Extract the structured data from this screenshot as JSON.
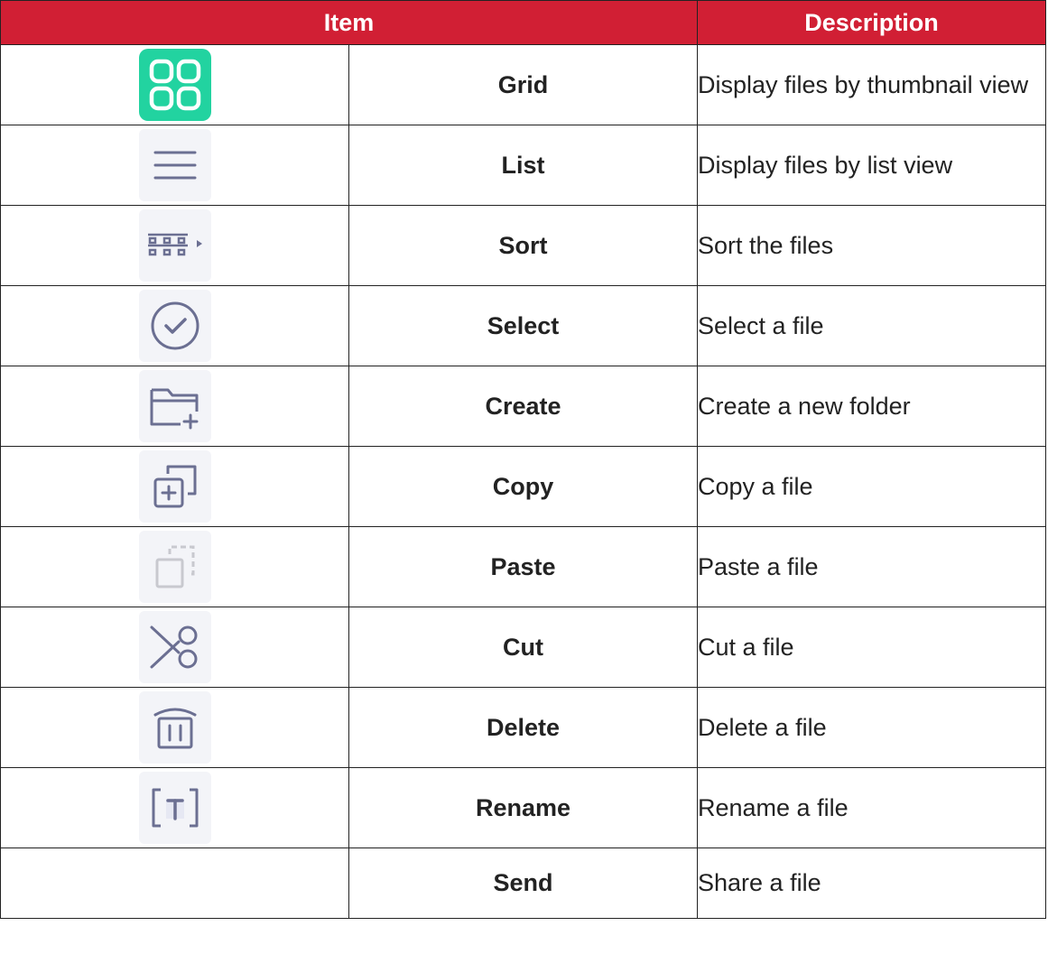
{
  "header": {
    "item": "Item",
    "description": "Description"
  },
  "rows": [
    {
      "icon": "grid-icon",
      "name": "Grid",
      "description": "Display files by thumbnail view"
    },
    {
      "icon": "list-icon",
      "name": "List",
      "description": "Display files by list view"
    },
    {
      "icon": "sort-icon",
      "name": "Sort",
      "description": "Sort the files"
    },
    {
      "icon": "select-icon",
      "name": "Select",
      "description": "Select a file"
    },
    {
      "icon": "create-folder-icon",
      "name": "Create",
      "description": "Create a new folder"
    },
    {
      "icon": "copy-icon",
      "name": "Copy",
      "description": "Copy a file"
    },
    {
      "icon": "paste-icon",
      "name": "Paste",
      "description": "Paste a file"
    },
    {
      "icon": "cut-icon",
      "name": "Cut",
      "description": "Cut a file"
    },
    {
      "icon": "delete-icon",
      "name": "Delete",
      "description": "Delete a file"
    },
    {
      "icon": "rename-icon",
      "name": "Rename",
      "description": "Rename a file"
    },
    {
      "icon": "",
      "name": "Send",
      "description": "Share a file"
    }
  ],
  "colors": {
    "header_bg": "#d11f34",
    "grid_icon_bg": "#22d3a0",
    "icon_stroke": "#6b6f92"
  }
}
